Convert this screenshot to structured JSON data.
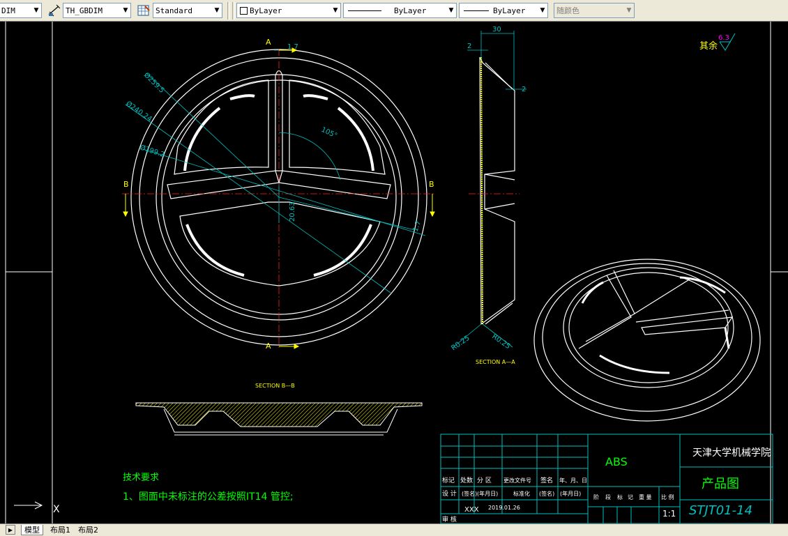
{
  "toolbar": {
    "dimstyle": "DIM",
    "dimstyle2": "TH_GBDIM",
    "tablestyle": "Standard",
    "layer_color": "ByLayer",
    "linetype": "ByLayer",
    "lineweight": "ByLayer",
    "plotstyle": "随颜色"
  },
  "tabs": [
    "模型",
    "布局1",
    "布局2"
  ],
  "drawing": {
    "dims_front": {
      "d1": "1.7",
      "d2": "Ø259.5",
      "d3": "Ø240.24",
      "d4": "Ø199.2",
      "angle": "105°",
      "d5": "20.63",
      "d6": "1.7"
    },
    "section_marks": {
      "a": "A",
      "b": "B"
    },
    "dims_side": {
      "w": "30",
      "t1": "2",
      "t2": "2",
      "r1": "R0.25",
      "r2": "R0.25"
    },
    "section_aa": "SECTION  A—A",
    "section_bb": "SECTION  B—B",
    "roughness": {
      "label": "其余",
      "value": "6.3"
    },
    "tech": {
      "title": "技术要求",
      "item": "1、图面中未标注的公差按照IT14 管控;"
    }
  },
  "title_block": {
    "material": "ABS",
    "school": "天津大学机械学院",
    "name": "产品图",
    "code": "STJT01-14",
    "scale": "1:1",
    "designer": "XXX",
    "date": "2019.01.26",
    "h": [
      "标记",
      "处数",
      "分 区",
      "更改文件号",
      "签名",
      "年、月、日"
    ],
    "r1": [
      "设 计",
      "(签名)",
      "(年月日)",
      "标准化",
      "(签名)",
      "(年月日)"
    ],
    "r2": [
      "审 核"
    ],
    "stage": [
      "阶",
      "段",
      "标",
      "记",
      "重 量",
      "比 例"
    ]
  }
}
